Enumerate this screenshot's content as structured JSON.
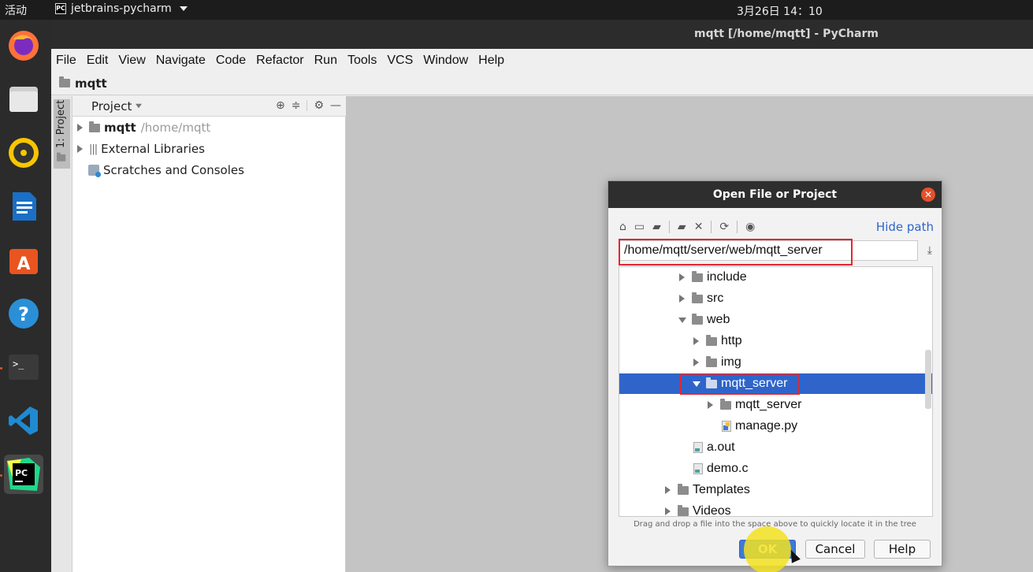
{
  "topbar": {
    "activities": "活动",
    "app_name": "jetbrains-pycharm",
    "clock": "3月26日 14：10"
  },
  "dock": {
    "items": [
      {
        "name": "firefox-icon",
        "color": "#ff7139"
      },
      {
        "name": "files-icon",
        "color": "#d9d9d9"
      },
      {
        "name": "rhythmbox-icon",
        "color": "#f7c600"
      },
      {
        "name": "writer-icon",
        "color": "#1a6fc6"
      },
      {
        "name": "software-icon",
        "color": "#e95420"
      },
      {
        "name": "help-icon",
        "color": "#2a8fd6"
      },
      {
        "name": "terminal-icon",
        "color": "#333333"
      },
      {
        "name": "vscode-icon",
        "color": "#1f8ad2"
      },
      {
        "name": "pycharm-icon",
        "color": "#21d789"
      }
    ]
  },
  "window": {
    "title": "mqtt [/home/mqtt] - PyCharm",
    "menus": [
      "File",
      "Edit",
      "View",
      "Navigate",
      "Code",
      "Refactor",
      "Run",
      "Tools",
      "VCS",
      "Window",
      "Help"
    ],
    "breadcrumb": "mqtt",
    "side_tab": "1: Project"
  },
  "project_panel": {
    "title": "Project",
    "tree": [
      {
        "label": "mqtt",
        "path": "/home/mqtt"
      },
      {
        "label": "External Libraries"
      },
      {
        "label": "Scratches and Consoles"
      }
    ]
  },
  "dialog": {
    "title": "Open File or Project",
    "hide_path": "Hide path",
    "path_value": "/home/mqtt/server/web/mqtt_server",
    "hint": "Drag and drop a file into the space above to quickly locate it in the tree",
    "ok": "OK",
    "cancel": "Cancel",
    "help": "Help",
    "tree": [
      {
        "label": "include",
        "type": "folder",
        "expanded": false
      },
      {
        "label": "src",
        "type": "folder",
        "expanded": false
      },
      {
        "label": "web",
        "type": "folder",
        "expanded": true
      },
      {
        "label": "http",
        "type": "folder",
        "expanded": false
      },
      {
        "label": "img",
        "type": "folder",
        "expanded": false
      },
      {
        "label": "mqtt_server",
        "type": "folder",
        "expanded": true,
        "selected": true
      },
      {
        "label": "mqtt_server",
        "type": "folder",
        "expanded": false
      },
      {
        "label": "manage.py",
        "type": "file"
      },
      {
        "label": "a.out",
        "type": "file"
      },
      {
        "label": "demo.c",
        "type": "file"
      },
      {
        "label": "Templates",
        "type": "folder",
        "expanded": false
      },
      {
        "label": "Videos",
        "type": "folder",
        "expanded": false
      }
    ]
  },
  "colors": {
    "selection": "#2f65ca",
    "highlight_box": "#e3262f",
    "link": "#2f65ca"
  }
}
